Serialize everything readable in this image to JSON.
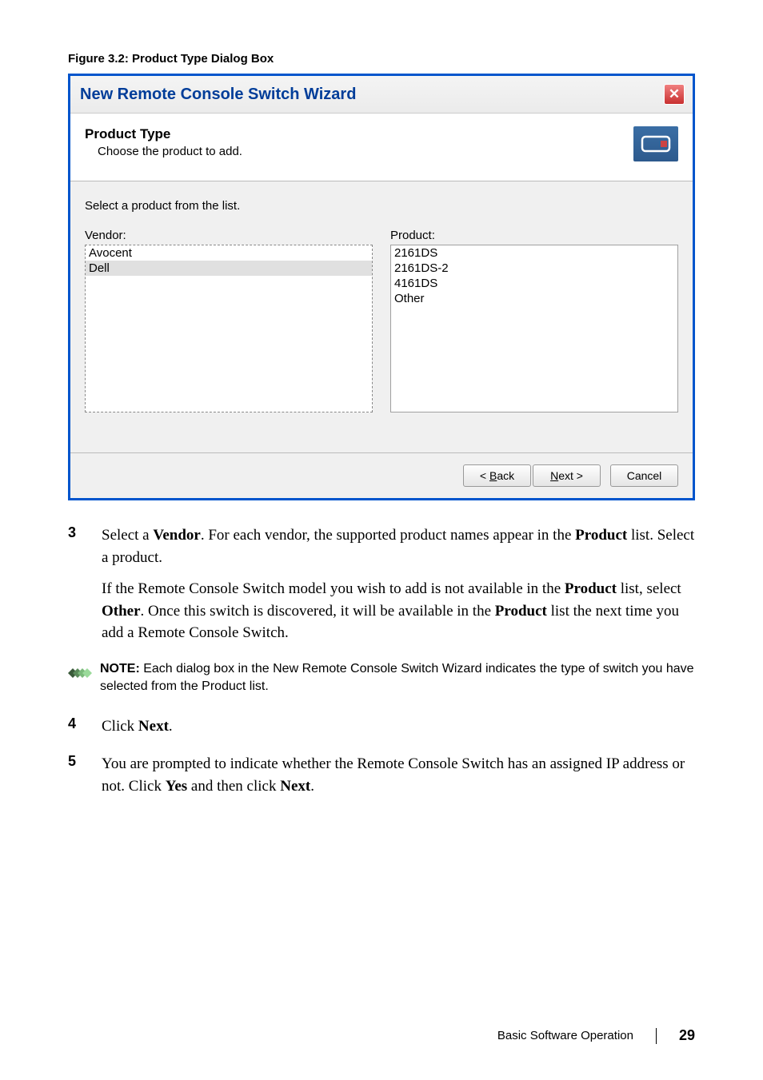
{
  "figure_caption": "Figure 3.2: Product Type Dialog Box",
  "wizard": {
    "title": "New Remote Console Switch Wizard",
    "header_main": "Product Type",
    "header_sub": "Choose the product to add.",
    "instruction": "Select a product from the list.",
    "vendor_label": "Vendor:",
    "product_label": "Product:",
    "vendors": [
      "Avocent",
      "Dell"
    ],
    "products": [
      "2161DS",
      "2161DS-2",
      "4161DS",
      "Other"
    ],
    "back_btn_prefix": "< ",
    "back_btn_u": "B",
    "back_btn_suffix": "ack",
    "next_btn_u": "N",
    "next_btn_suffix": "ext >",
    "cancel_btn": "Cancel"
  },
  "steps": {
    "s3_num": "3",
    "s3_p1_a": "Select a ",
    "s3_p1_b": "Vendor",
    "s3_p1_c": ". For each vendor, the supported product names appear in the ",
    "s3_p1_d": "Product",
    "s3_p1_e": " list. Select a product.",
    "s3_p2_a": "If the Remote Console Switch model you wish to add is not available in the ",
    "s3_p2_b": "Product",
    "s3_p2_c": " list, select ",
    "s3_p2_d": "Other",
    "s3_p2_e": ". Once this switch is discovered, it will be available in the ",
    "s3_p2_f": "Product",
    "s3_p2_g": " list the next time you add a Remote Console Switch.",
    "s4_num": "4",
    "s4_a": "Click ",
    "s4_b": "Next",
    "s4_c": ".",
    "s5_num": "5",
    "s5_a": "You are prompted to indicate whether the Remote Console Switch has an assigned IP address or not. Click ",
    "s5_b": "Yes",
    "s5_c": " and then click ",
    "s5_d": "Next",
    "s5_e": "."
  },
  "note": {
    "label": "NOTE:",
    "text": " Each dialog box in the New Remote Console Switch Wizard indicates the type of switch you have selected from the Product list."
  },
  "footer": {
    "section": "Basic Software Operation",
    "page": "29"
  }
}
